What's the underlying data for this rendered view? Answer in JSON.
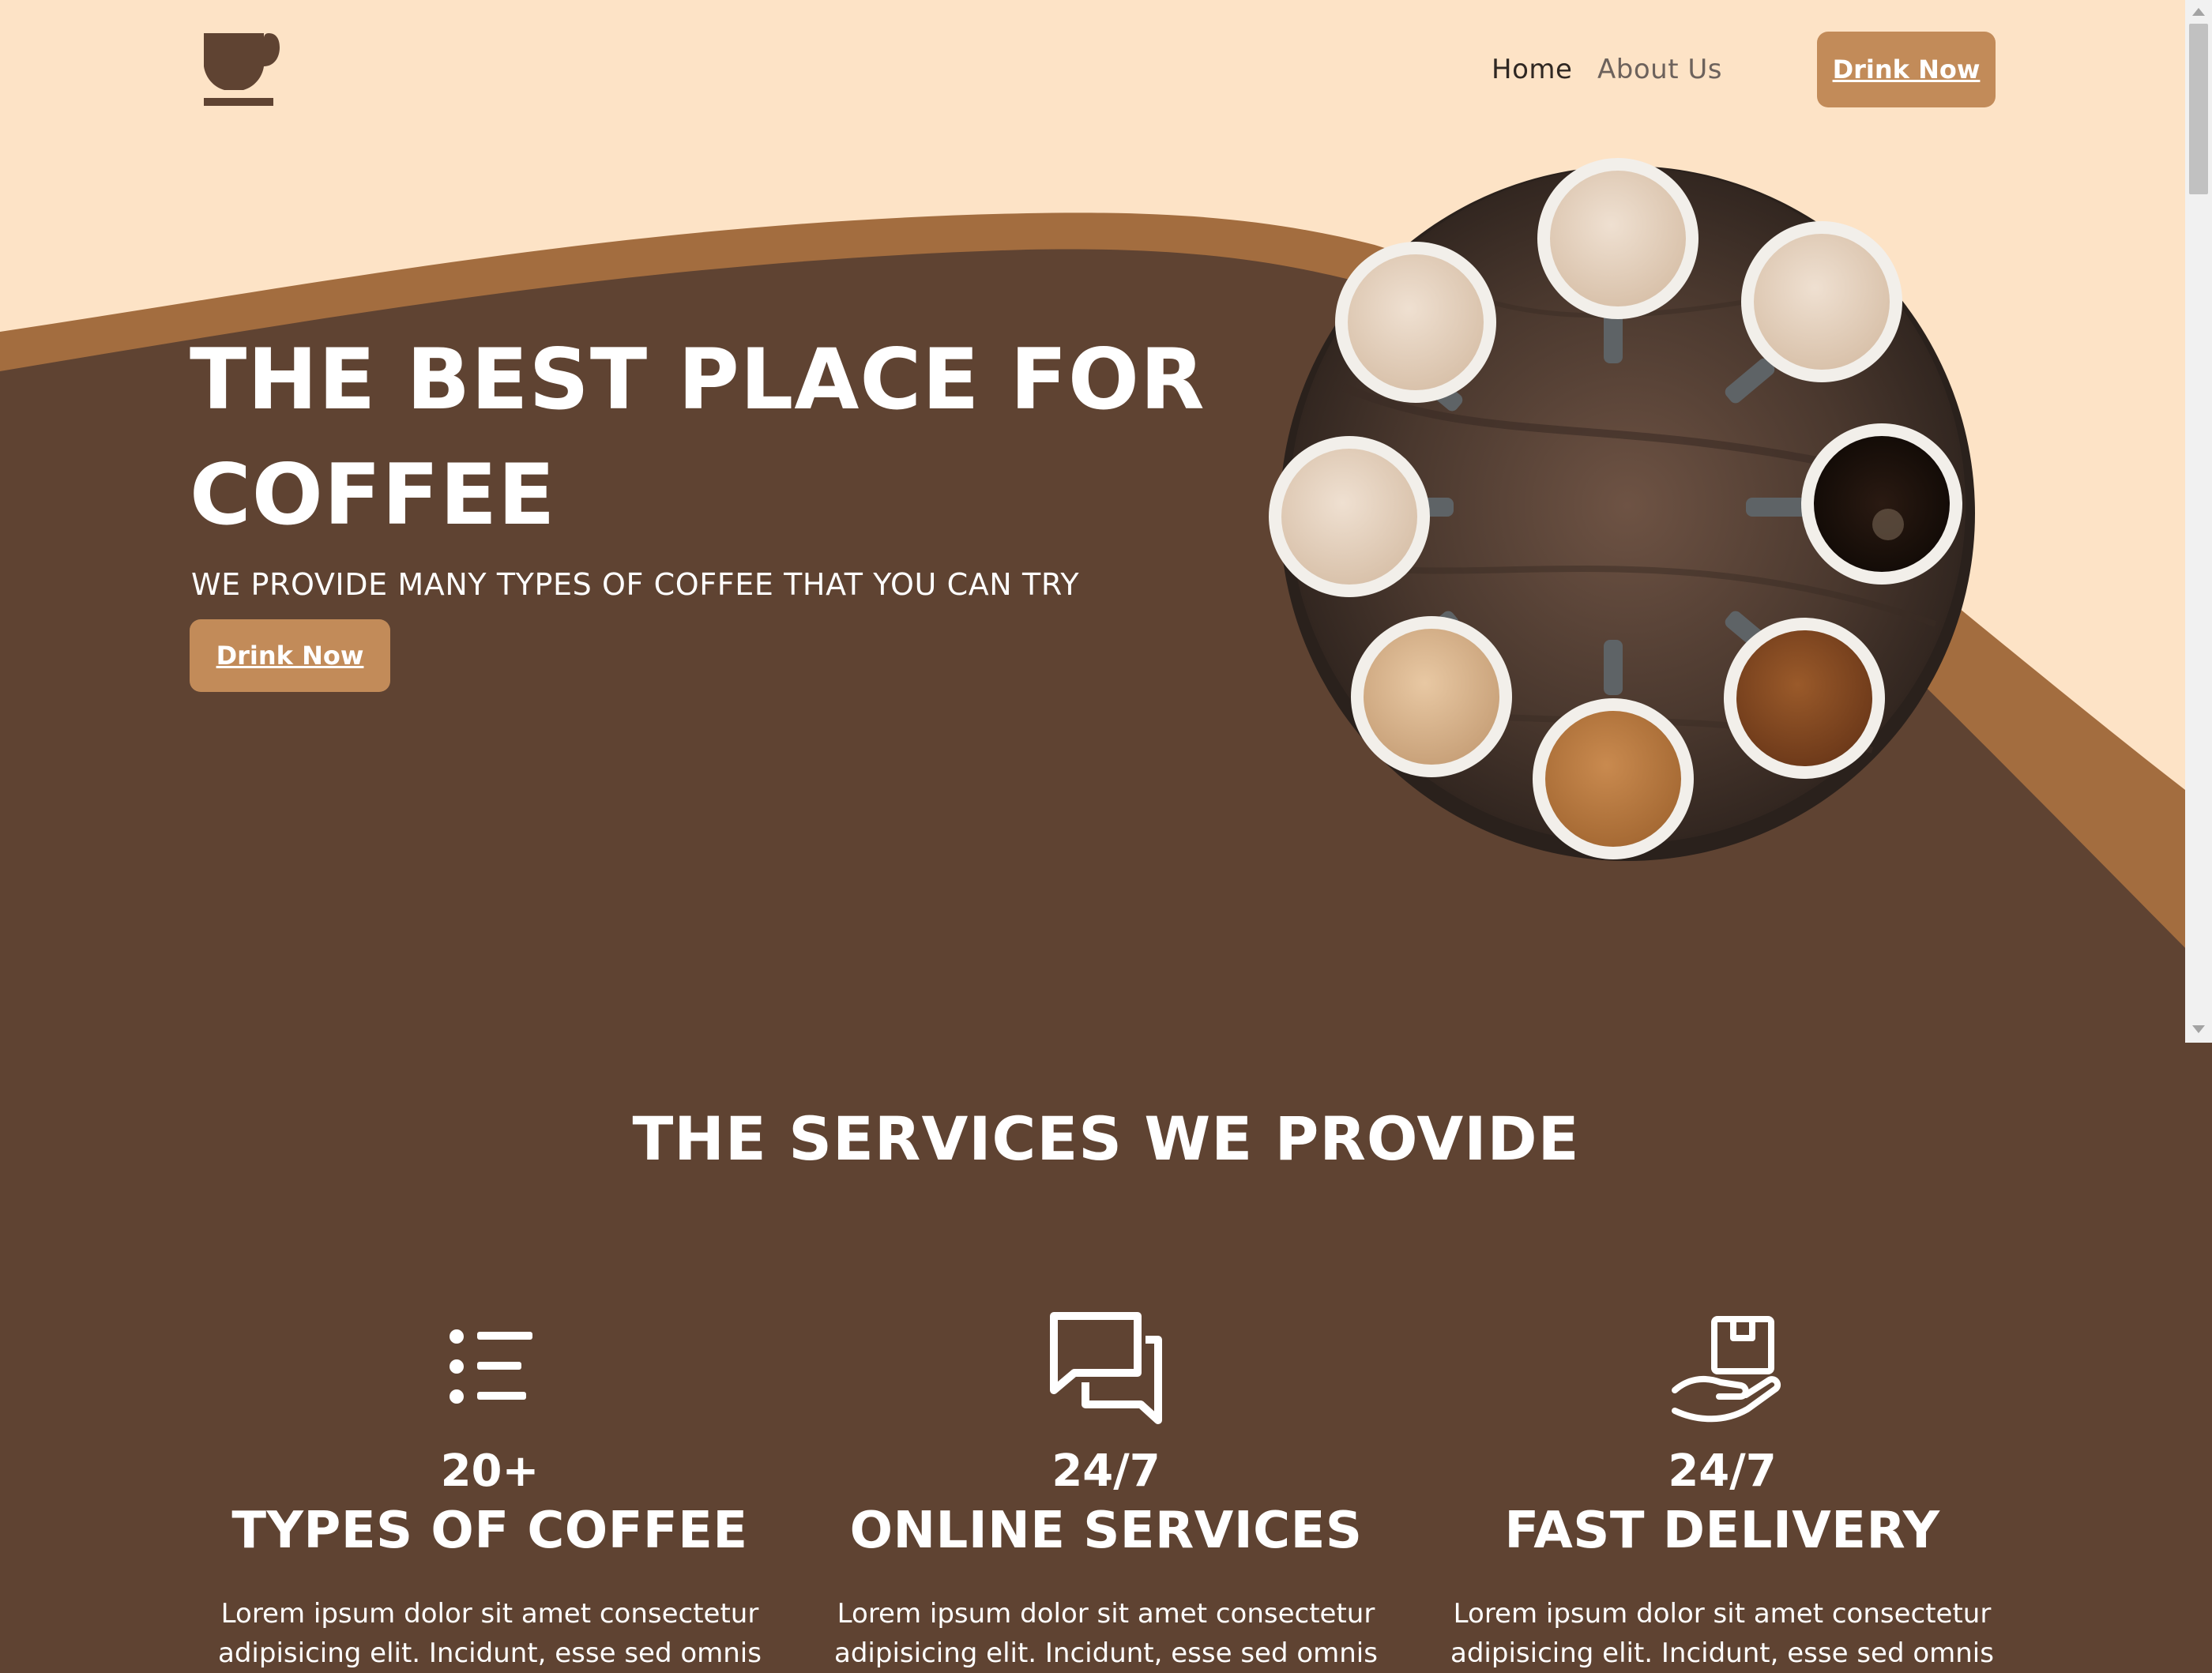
{
  "colors": {
    "cream": "#fde3c6",
    "dark_brown": "#5f4332",
    "wave_brown": "#a36d3f",
    "accent": "#c28b59",
    "text_light": "#ffffff"
  },
  "navbar": {
    "logo_icon": "coffee-cup-icon",
    "links": [
      {
        "label": "Home",
        "active": true
      },
      {
        "label": "About Us",
        "active": false
      }
    ],
    "cta_label": "Drink Now"
  },
  "hero": {
    "title": "THE BEST PLACE FOR COFFEE",
    "subtitle": "WE PROVIDE MANY TYPES OF COFFEE THAT YOU CAN TRY",
    "cta_label": "Drink Now",
    "image": "coffee-cups-on-table-photo"
  },
  "services": {
    "title": "THE SERVICES WE PROVIDE",
    "items": [
      {
        "icon": "list-icon",
        "number": "20+",
        "label": "TYPES OF COFFEE",
        "description": "Lorem ipsum dolor sit amet consectetur adipisicing elit. Incidunt, esse sed omnis"
      },
      {
        "icon": "chat-icon",
        "number": "24/7",
        "label": "ONLINE SERVICES",
        "description": "Lorem ipsum dolor sit amet consectetur adipisicing elit. Incidunt, esse sed omnis"
      },
      {
        "icon": "hand-box-delivery-icon",
        "number": "24/7",
        "label": "FAST DELIVERY",
        "description": "Lorem ipsum dolor sit amet consectetur adipisicing elit. Incidunt, esse sed omnis"
      }
    ]
  }
}
